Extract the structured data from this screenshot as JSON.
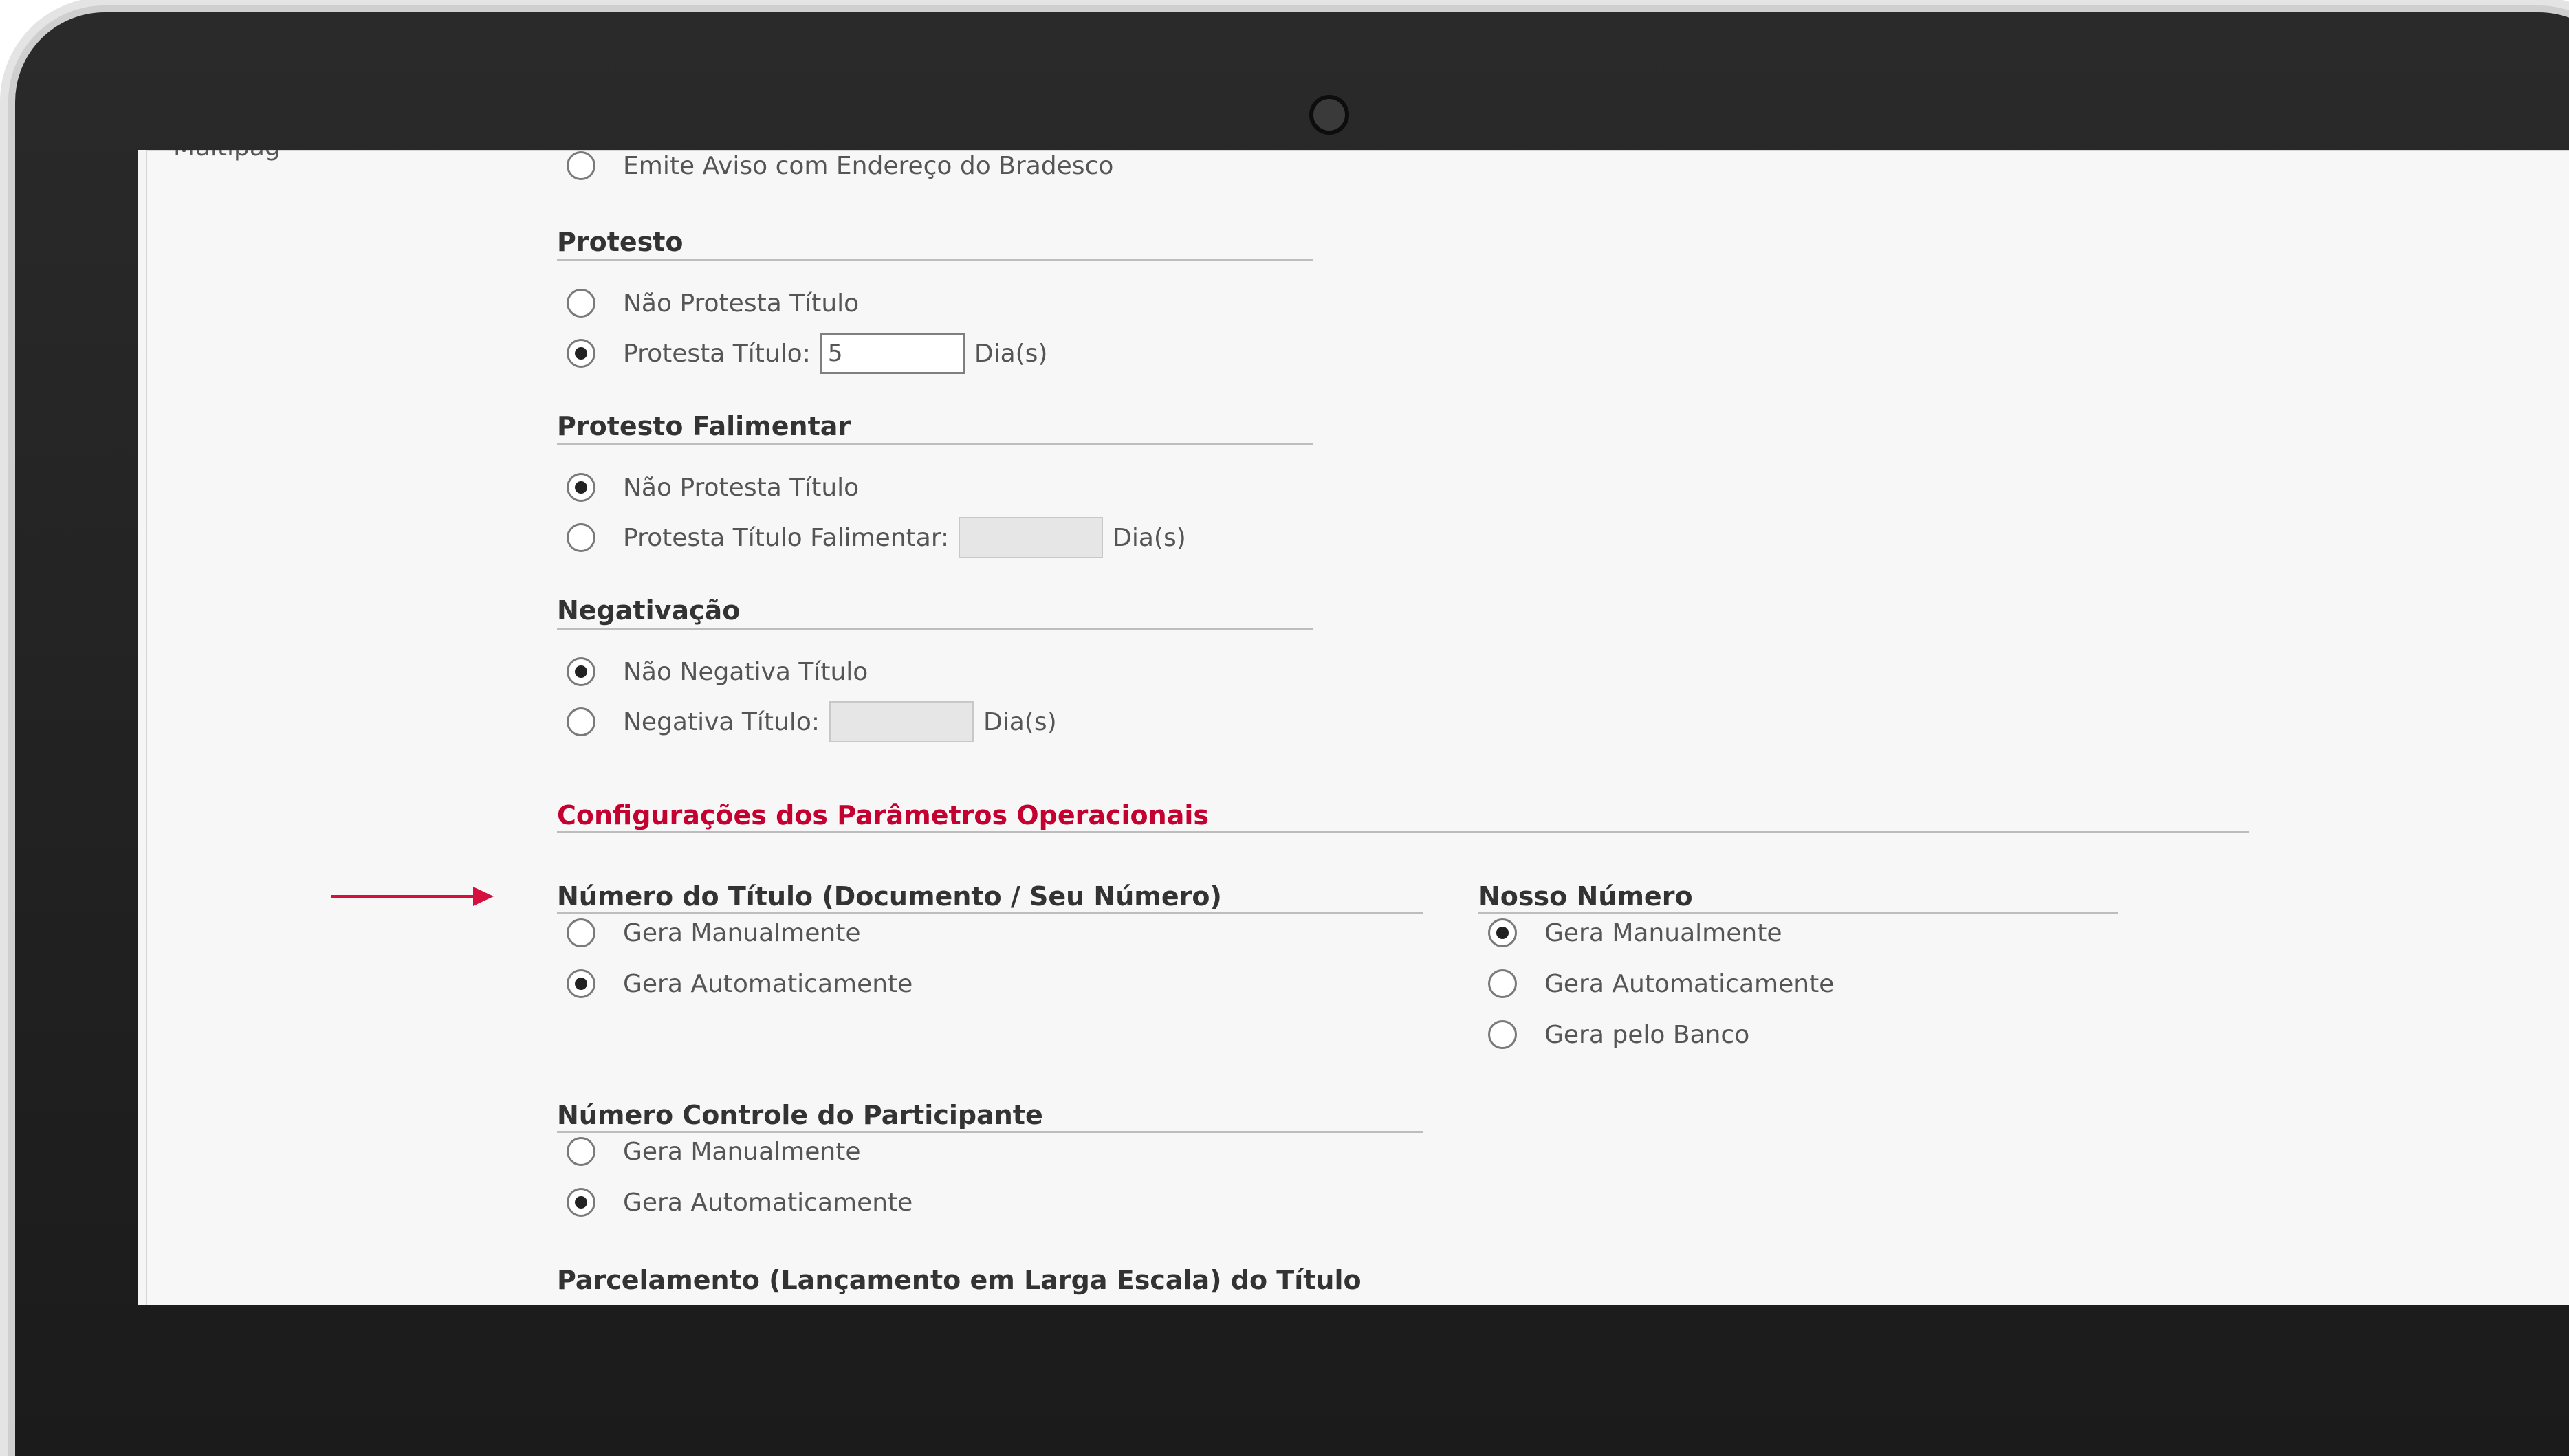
{
  "sidebar": {
    "item": "Multipag"
  },
  "emite_aviso": {
    "label": "Emite Aviso com Endereço do Bradesco"
  },
  "protesto": {
    "title": "Protesto",
    "nao_protesta": "Não Protesta Título",
    "protesta_label": "Protesta Título:",
    "protesta_value": "5",
    "unit": "Dia(s)"
  },
  "protesto_falimentar": {
    "title": "Protesto Falimentar",
    "nao_protesta": "Não Protesta Título",
    "protesta_label": "Protesta Título Falimentar:",
    "unit": "Dia(s)"
  },
  "negativacao": {
    "title": "Negativação",
    "nao_negativa": "Não Negativa Título",
    "negativa_label": "Negativa Título:",
    "unit": "Dia(s)"
  },
  "config": {
    "title": "Configurações dos Parâmetros Operacionais"
  },
  "numero_titulo": {
    "title": "Número do Título (Documento / Seu Número)",
    "manual": "Gera Manualmente",
    "auto": "Gera Automaticamente"
  },
  "nosso_numero": {
    "title": "Nosso Número",
    "manual": "Gera Manualmente",
    "auto": "Gera Automaticamente",
    "banco": "Gera pelo Banco"
  },
  "controle": {
    "title": "Número Controle do Participante",
    "manual": "Gera Manualmente",
    "auto": "Gera Automaticamente"
  },
  "parcelamento": {
    "title": "Parcelamento (Lançamento em Larga Escala) do Título"
  },
  "colors": {
    "accent": "#c3002f",
    "arrow": "#d4103f"
  }
}
